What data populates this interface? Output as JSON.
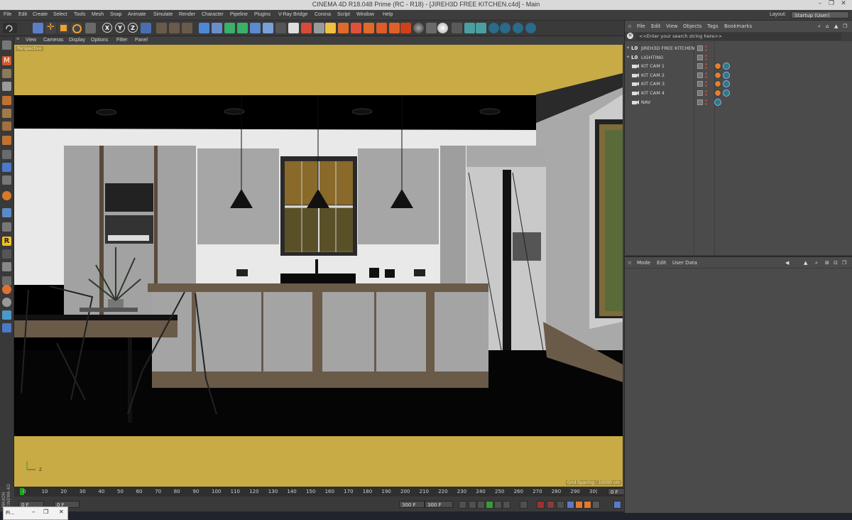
{
  "window": {
    "title": "CINEMA 4D R18.048 Prime (RC - R18) - [JIREH3D FREE KITCHEN.c4d] - Main",
    "controls": [
      "–",
      "❐",
      "✕"
    ]
  },
  "menu": {
    "items": [
      "File",
      "Edit",
      "Create",
      "Select",
      "Tools",
      "Mesh",
      "Snap",
      "Animate",
      "Simulate",
      "Render",
      "Character",
      "Pipeline",
      "Plugins",
      "V-Ray Bridge",
      "Corona",
      "Script",
      "Window",
      "Help"
    ],
    "layout_label": "Layout:",
    "layout_value": "Startup (User)"
  },
  "toolbar": {
    "axis_labels": [
      "X",
      "Y",
      "Z"
    ],
    "icons": [
      "undo-icon",
      "select-icon",
      "move-icon",
      "scale-icon",
      "rotate-icon",
      "last-tool-icon",
      "x-axis-icon",
      "y-axis-icon",
      "z-axis-icon",
      "coordinate-system-icon",
      "render-view-icon",
      "render-picture-viewer-icon",
      "render-settings-icon",
      "cube-icon",
      "pen-icon",
      "subdivision-icon",
      "array-icon",
      "deformer-icon",
      "floor-icon",
      "camera-icon",
      "light-icon",
      "material-icon"
    ]
  },
  "viewport": {
    "menu": [
      "View",
      "Cameras",
      "Display",
      "Options",
      "Filter",
      "Panel"
    ],
    "mode_label": "Perspective",
    "grid_spacing": "Grid Spacing : 10000 cm",
    "bg_color": "#c8ab44",
    "axis_label": "Z"
  },
  "timeline": {
    "ticks": [
      "0",
      "10",
      "20",
      "30",
      "40",
      "50",
      "60",
      "70",
      "80",
      "90",
      "100",
      "110",
      "120",
      "130",
      "140",
      "150",
      "160",
      "170",
      "180",
      "190",
      "200",
      "210",
      "220",
      "230",
      "240",
      "250",
      "260",
      "270",
      "280",
      "290",
      "30("
    ],
    "current_frame": "0 F",
    "start_frame": "0 F",
    "min_frame": "0 F",
    "end_value": "300 F",
    "end_frame": "300 F"
  },
  "taskbar": {
    "app_label": "Pi..."
  },
  "object_manager": {
    "menu": [
      "File",
      "Edit",
      "View",
      "Objects",
      "Tags",
      "Bookmarks"
    ],
    "search_placeholder": "<<Enter your search string here>>",
    "objects": [
      {
        "name": "JIREH3D FREE KITCHEN",
        "icon": "L0",
        "tags": 0
      },
      {
        "name": "LIGHTING",
        "icon": "L0",
        "tags": 0
      },
      {
        "name": "KIT CAM 1",
        "icon": "cam",
        "tags": 2
      },
      {
        "name": "KIT CAM 2",
        "icon": "cam",
        "tags": 2
      },
      {
        "name": "KIT CAM 3",
        "icon": "cam",
        "tags": 2
      },
      {
        "name": "KIT CAM 4",
        "icon": "cam",
        "tags": 2
      },
      {
        "name": "NAV",
        "icon": "cam",
        "tags": 1
      }
    ]
  },
  "attribute_manager": {
    "menu": [
      "Mode",
      "Edit",
      "User Data"
    ]
  },
  "logo_text": "MAXON CINEMA 4D"
}
